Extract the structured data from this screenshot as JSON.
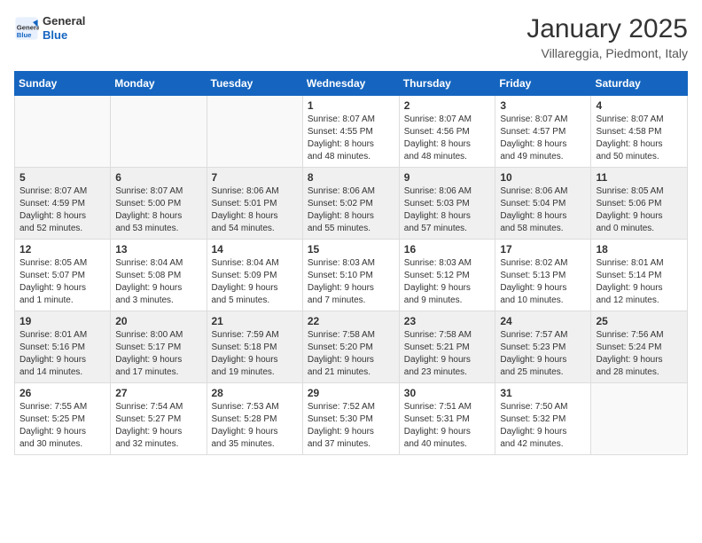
{
  "logo": {
    "general": "General",
    "blue": "Blue"
  },
  "title": "January 2025",
  "location": "Villareggia, Piedmont, Italy",
  "weekdays": [
    "Sunday",
    "Monday",
    "Tuesday",
    "Wednesday",
    "Thursday",
    "Friday",
    "Saturday"
  ],
  "weeks": [
    [
      {
        "day": "",
        "info": ""
      },
      {
        "day": "",
        "info": ""
      },
      {
        "day": "",
        "info": ""
      },
      {
        "day": "1",
        "info": "Sunrise: 8:07 AM\nSunset: 4:55 PM\nDaylight: 8 hours\nand 48 minutes."
      },
      {
        "day": "2",
        "info": "Sunrise: 8:07 AM\nSunset: 4:56 PM\nDaylight: 8 hours\nand 48 minutes."
      },
      {
        "day": "3",
        "info": "Sunrise: 8:07 AM\nSunset: 4:57 PM\nDaylight: 8 hours\nand 49 minutes."
      },
      {
        "day": "4",
        "info": "Sunrise: 8:07 AM\nSunset: 4:58 PM\nDaylight: 8 hours\nand 50 minutes."
      }
    ],
    [
      {
        "day": "5",
        "info": "Sunrise: 8:07 AM\nSunset: 4:59 PM\nDaylight: 8 hours\nand 52 minutes."
      },
      {
        "day": "6",
        "info": "Sunrise: 8:07 AM\nSunset: 5:00 PM\nDaylight: 8 hours\nand 53 minutes."
      },
      {
        "day": "7",
        "info": "Sunrise: 8:06 AM\nSunset: 5:01 PM\nDaylight: 8 hours\nand 54 minutes."
      },
      {
        "day": "8",
        "info": "Sunrise: 8:06 AM\nSunset: 5:02 PM\nDaylight: 8 hours\nand 55 minutes."
      },
      {
        "day": "9",
        "info": "Sunrise: 8:06 AM\nSunset: 5:03 PM\nDaylight: 8 hours\nand 57 minutes."
      },
      {
        "day": "10",
        "info": "Sunrise: 8:06 AM\nSunset: 5:04 PM\nDaylight: 8 hours\nand 58 minutes."
      },
      {
        "day": "11",
        "info": "Sunrise: 8:05 AM\nSunset: 5:06 PM\nDaylight: 9 hours\nand 0 minutes."
      }
    ],
    [
      {
        "day": "12",
        "info": "Sunrise: 8:05 AM\nSunset: 5:07 PM\nDaylight: 9 hours\nand 1 minute."
      },
      {
        "day": "13",
        "info": "Sunrise: 8:04 AM\nSunset: 5:08 PM\nDaylight: 9 hours\nand 3 minutes."
      },
      {
        "day": "14",
        "info": "Sunrise: 8:04 AM\nSunset: 5:09 PM\nDaylight: 9 hours\nand 5 minutes."
      },
      {
        "day": "15",
        "info": "Sunrise: 8:03 AM\nSunset: 5:10 PM\nDaylight: 9 hours\nand 7 minutes."
      },
      {
        "day": "16",
        "info": "Sunrise: 8:03 AM\nSunset: 5:12 PM\nDaylight: 9 hours\nand 9 minutes."
      },
      {
        "day": "17",
        "info": "Sunrise: 8:02 AM\nSunset: 5:13 PM\nDaylight: 9 hours\nand 10 minutes."
      },
      {
        "day": "18",
        "info": "Sunrise: 8:01 AM\nSunset: 5:14 PM\nDaylight: 9 hours\nand 12 minutes."
      }
    ],
    [
      {
        "day": "19",
        "info": "Sunrise: 8:01 AM\nSunset: 5:16 PM\nDaylight: 9 hours\nand 14 minutes."
      },
      {
        "day": "20",
        "info": "Sunrise: 8:00 AM\nSunset: 5:17 PM\nDaylight: 9 hours\nand 17 minutes."
      },
      {
        "day": "21",
        "info": "Sunrise: 7:59 AM\nSunset: 5:18 PM\nDaylight: 9 hours\nand 19 minutes."
      },
      {
        "day": "22",
        "info": "Sunrise: 7:58 AM\nSunset: 5:20 PM\nDaylight: 9 hours\nand 21 minutes."
      },
      {
        "day": "23",
        "info": "Sunrise: 7:58 AM\nSunset: 5:21 PM\nDaylight: 9 hours\nand 23 minutes."
      },
      {
        "day": "24",
        "info": "Sunrise: 7:57 AM\nSunset: 5:23 PM\nDaylight: 9 hours\nand 25 minutes."
      },
      {
        "day": "25",
        "info": "Sunrise: 7:56 AM\nSunset: 5:24 PM\nDaylight: 9 hours\nand 28 minutes."
      }
    ],
    [
      {
        "day": "26",
        "info": "Sunrise: 7:55 AM\nSunset: 5:25 PM\nDaylight: 9 hours\nand 30 minutes."
      },
      {
        "day": "27",
        "info": "Sunrise: 7:54 AM\nSunset: 5:27 PM\nDaylight: 9 hours\nand 32 minutes."
      },
      {
        "day": "28",
        "info": "Sunrise: 7:53 AM\nSunset: 5:28 PM\nDaylight: 9 hours\nand 35 minutes."
      },
      {
        "day": "29",
        "info": "Sunrise: 7:52 AM\nSunset: 5:30 PM\nDaylight: 9 hours\nand 37 minutes."
      },
      {
        "day": "30",
        "info": "Sunrise: 7:51 AM\nSunset: 5:31 PM\nDaylight: 9 hours\nand 40 minutes."
      },
      {
        "day": "31",
        "info": "Sunrise: 7:50 AM\nSunset: 5:32 PM\nDaylight: 9 hours\nand 42 minutes."
      },
      {
        "day": "",
        "info": ""
      }
    ]
  ]
}
